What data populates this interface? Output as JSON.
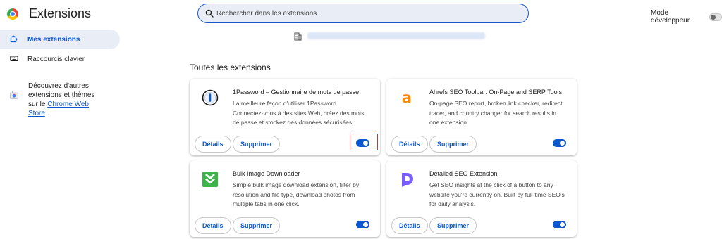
{
  "header": {
    "title": "Extensions",
    "search_placeholder": "Rechercher dans les extensions",
    "dev_mode_label": "Mode développeur"
  },
  "sidebar": {
    "items": [
      {
        "label": "Mes extensions",
        "icon": "puzzle-icon",
        "active": true
      },
      {
        "label": "Raccourcis clavier",
        "icon": "keyboard-icon",
        "active": false
      }
    ],
    "promo_text": "Découvrez d'autres extensions et thèmes sur le",
    "promo_link": "Chrome Web Store",
    "promo_suffix": "."
  },
  "section_title": "Toutes les extensions",
  "extensions": [
    {
      "name": "1Password – Gestionnaire de mots de passe",
      "description": "La meilleure façon d'utiliser 1Password. Connectez-vous à des sites Web, créez des mots de passe et stockez des données sécurisées.",
      "details_label": "Détails",
      "remove_label": "Supprimer",
      "enabled": true,
      "icon": "1password-icon"
    },
    {
      "name": "Ahrefs SEO Toolbar: On-Page and SERP Tools",
      "description": "On-page SEO report, broken link checker, redirect tracer, and country changer for search results in one extension.",
      "details_label": "Détails",
      "remove_label": "Supprimer",
      "enabled": true,
      "icon": "ahrefs-icon"
    },
    {
      "name": "Bulk Image Downloader",
      "description": "Simple bulk image download extension, filter by resolution and file type, download photos from multiple tabs in one click.",
      "details_label": "Détails",
      "remove_label": "Supprimer",
      "enabled": true,
      "icon": "bulk-image-downloader-icon"
    },
    {
      "name": "Detailed SEO Extension",
      "description": "Get SEO insights at the click of a button to any website you're currently on. Built by full-time SEO's for daily analysis.",
      "details_label": "Détails",
      "remove_label": "Supprimer",
      "enabled": true,
      "icon": "detailed-seo-icon"
    }
  ],
  "colors": {
    "accent": "#0b57d0",
    "highlight": "#e12a2a",
    "ahrefs": "#ff8800",
    "bulk": "#3bb54a",
    "detailed": "#7b5cff"
  }
}
